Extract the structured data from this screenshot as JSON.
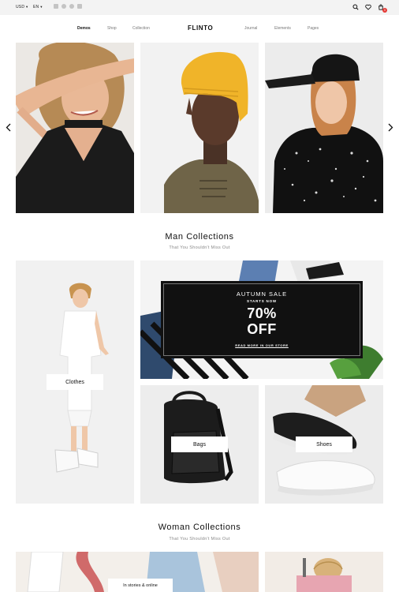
{
  "topbar": {
    "currency": "USD",
    "language": "EN",
    "socials": [
      "facebook-icon",
      "twitter-icon",
      "pinterest-icon",
      "youtube-icon"
    ],
    "cart_count": "0"
  },
  "nav": {
    "left": [
      "Demos",
      "Shop",
      "Collection"
    ],
    "logo": "FLINTO",
    "right": [
      "Journal",
      "Elements",
      "Pages"
    ],
    "active": "Demos"
  },
  "man_section": {
    "title": "Man Collections",
    "subtitle": "That You Shouldn't Miss Out"
  },
  "promo": {
    "title": "AUTUMN SALE",
    "subtitle": "STARTS NOW",
    "discount_line1": "70%",
    "discount_line2": "OFF",
    "link": "READ MORE IN OUR STORE"
  },
  "categories": {
    "clothes": "Clothes",
    "bags": "Bags",
    "shoes": "Shoes"
  },
  "woman_section": {
    "title": "Woman Collections",
    "subtitle": "That You Shouldn't Miss Out",
    "story_label": "In stories & online"
  },
  "colors": {
    "topbar_bg": "#f3f3f3",
    "accent_badge": "#e53935",
    "promo_bg": "#111111",
    "beanie": "#f0b429"
  }
}
